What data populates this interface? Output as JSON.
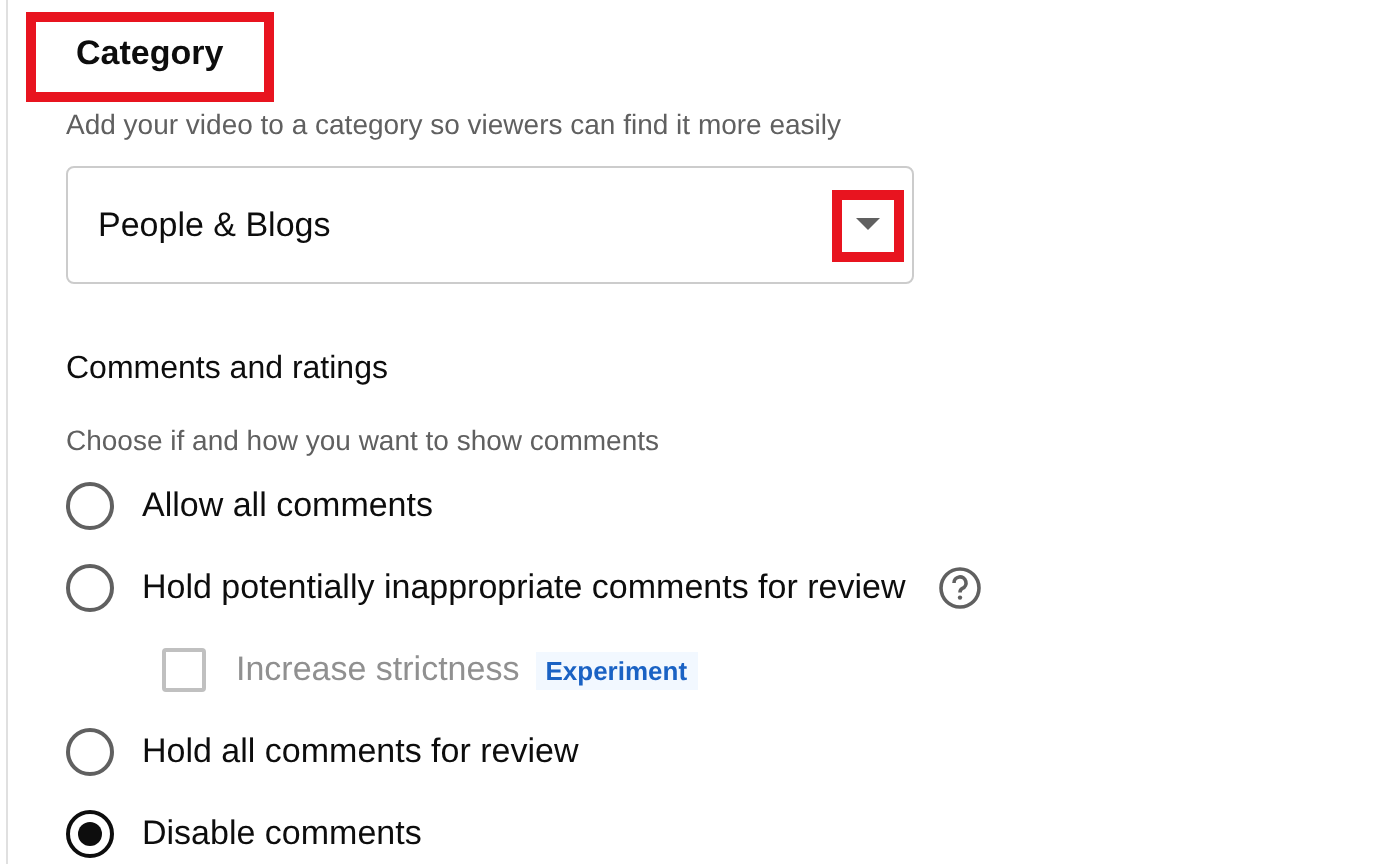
{
  "category": {
    "heading": "Category",
    "heading_highlighted": true,
    "description": "Add your video to a category so viewers can find it more easily",
    "dropdown": {
      "value": "People & Blogs",
      "arrow_highlighted": true
    }
  },
  "comments": {
    "heading": "Comments and ratings",
    "description": "Choose if and how you want to show comments",
    "options": [
      {
        "kind": "radio",
        "label": "Allow all comments",
        "selected": false
      },
      {
        "kind": "radio",
        "label": "Hold potentially inappropriate comments for review",
        "selected": false,
        "help": true
      },
      {
        "kind": "checkbox",
        "label": "Increase strictness",
        "checked": false,
        "disabled": true,
        "badge": "Experiment"
      },
      {
        "kind": "radio",
        "label": "Hold all comments for review",
        "selected": false
      },
      {
        "kind": "radio",
        "label": "Disable comments",
        "selected": true
      }
    ]
  }
}
